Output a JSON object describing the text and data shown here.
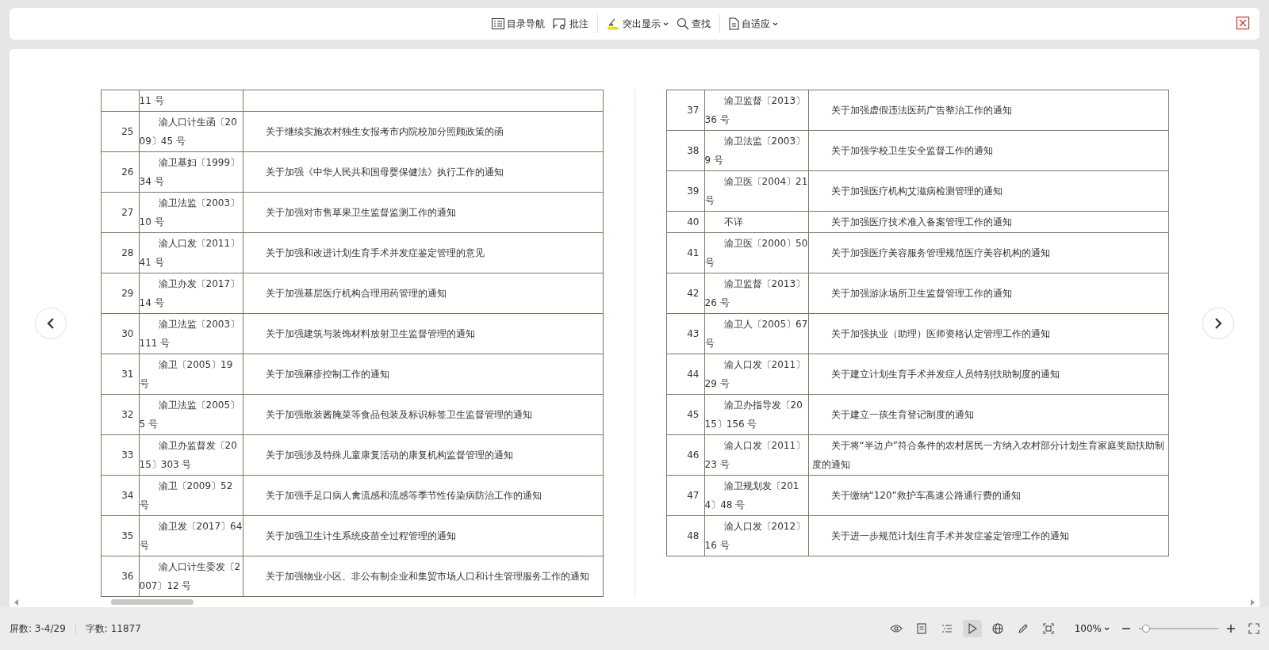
{
  "toolbar": {
    "groups": [
      [
        {
          "kind": "button",
          "label": "目录导航"
        },
        {
          "kind": "button",
          "label": "批注"
        }
      ],
      [
        {
          "kind": "dropdown",
          "label": "突出显示"
        },
        {
          "kind": "button",
          "label": "查找"
        }
      ],
      [
        {
          "kind": "dropdown",
          "label": "自适应"
        }
      ]
    ]
  },
  "pages": [
    {
      "rows": [
        {
          "number": "",
          "doc": "11 号",
          "title": "",
          "kind": "continued"
        },
        {
          "number": "25",
          "doc": "渝人口计生函〔2009〕45 号",
          "title": "关于继续实施农村独生女报考市内院校加分照顾政策的函"
        },
        {
          "number": "26",
          "doc": "渝卫基妇〔1999〕34 号",
          "title": "关于加强《中华人民共和国母婴保健法》执行工作的通知"
        },
        {
          "number": "27",
          "doc": "渝卫法监〔2003〕10 号",
          "title": "关于加强对市售草果卫生监督监测工作的通知"
        },
        {
          "number": "28",
          "doc": "渝人口发〔2011〕41 号",
          "title": "关于加强和改进计划生育手术并发症鉴定管理的意见"
        },
        {
          "number": "29",
          "doc": "渝卫办发〔2017〕14 号",
          "title": "关于加强基层医疗机构合理用药管理的通知"
        },
        {
          "number": "30",
          "doc": "渝卫法监〔2003〕111 号",
          "title": "关于加强建筑与装饰材料放射卫生监督管理的通知"
        },
        {
          "number": "31",
          "doc": "渝卫〔2005〕19 号",
          "title": "关于加强麻疹控制工作的通知"
        },
        {
          "number": "32",
          "doc": "渝卫法监〔2005〕5 号",
          "title": "关于加强散装酱腌菜等食品包装及标识标签卫生监督管理的通知"
        },
        {
          "number": "33",
          "doc": "渝卫办监督发〔2015〕303 号",
          "title": "关于加强涉及特殊儿童康复活动的康复机构监督管理的通知"
        },
        {
          "number": "34",
          "doc": "渝卫〔2009〕52 号",
          "title": "关于加强手足口病人禽流感和流感等季节性传染病防治工作的通知"
        },
        {
          "number": "35",
          "doc": "渝卫发〔2017〕64 号",
          "title": "关于加强卫生计生系统疫苗全过程管理的通知"
        },
        {
          "number": "36",
          "doc": "渝人口计生委发〔2007〕12 号",
          "title": "关于加强物业小区、非公有制企业和集贸市场人口和计生管理服务工作的通知"
        }
      ]
    },
    {
      "rows": [
        {
          "number": "37",
          "doc": "渝卫监督〔2013〕36 号",
          "title": "关于加强虚假违法医药广告整治工作的通知"
        },
        {
          "number": "38",
          "doc": "渝卫法监〔2003〕9 号",
          "title": "关于加强学校卫生安全监督工作的通知"
        },
        {
          "number": "39",
          "doc": "渝卫医〔2004〕21 号",
          "title": "关于加强医疗机构艾滋病检测管理的通知"
        },
        {
          "number": "40",
          "doc": "不详",
          "title": "关于加强医疗技术准入备案管理工作的通知"
        },
        {
          "number": "41",
          "doc": "渝卫医〔2000〕50 号",
          "title": "关于加强医疗美容服务管理规范医疗美容机构的通知"
        },
        {
          "number": "42",
          "doc": "渝卫监督〔2013〕26 号",
          "title": "关于加强游泳场所卫生监督管理工作的通知"
        },
        {
          "number": "43",
          "doc": "渝卫人〔2005〕67 号",
          "title": "关于加强执业（助理）医师资格认定管理工作的通知"
        },
        {
          "number": "44",
          "doc": "渝人口发〔2011〕29 号",
          "title": "关于建立计划生育手术并发症人员特别扶助制度的通知"
        },
        {
          "number": "45",
          "doc": "渝卫办指导发〔2015〕156 号",
          "title": "关于建立一孩生育登记制度的通知"
        },
        {
          "number": "46",
          "doc": "渝人口发〔2011〕23 号",
          "title": "关于将“半边户”符合条件的农村居民一方纳入农村部分计划生育家庭奖励扶助制度的通知"
        },
        {
          "number": "47",
          "doc": "渝卫规划发〔2014〕48 号",
          "title": "关于缴纳“120”救护车高速公路通行费的通知"
        },
        {
          "number": "48",
          "doc": "渝人口发〔2012〕16 号",
          "title": "关于进一步规范计划生育手术并发症鉴定管理工作的通知"
        }
      ]
    }
  ],
  "status_bar": {
    "screens": "屏数: 3-4/29",
    "words": "字数: 11877",
    "view_modes": [
      {
        "selected": false
      },
      {
        "selected": false
      },
      {
        "selected": false
      },
      {
        "selected": true
      },
      {
        "selected": false
      },
      {
        "selected": false
      },
      {
        "selected": false
      }
    ],
    "zoom": "100%",
    "zoom_slider": {
      "level": 0.04
    }
  }
}
